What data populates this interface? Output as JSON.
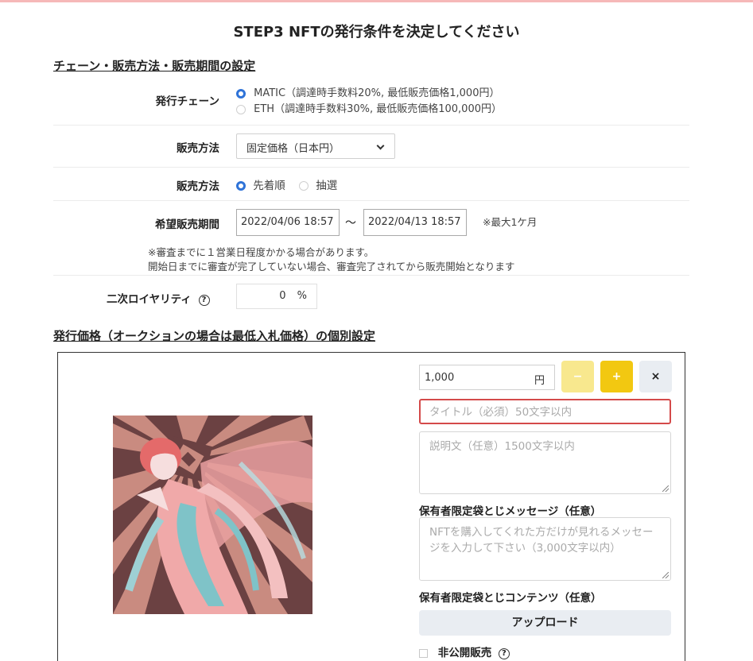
{
  "step_title": "STEP3 NFTの発行条件を決定してください",
  "section1_title": "チェーン・販売方法・販売期間の設定",
  "chain": {
    "label": "発行チェーン",
    "options": [
      {
        "text": "MATIC（調達時手数料20%, 最低販売価格1,000円）",
        "selected": true
      },
      {
        "text": "ETH（調達時手数料30%, 最低販売価格100,000円）",
        "selected": false
      }
    ]
  },
  "sale_method_1": {
    "label": "販売方法",
    "selected_value": "固定価格（日本円）"
  },
  "sale_method_2": {
    "label": "販売方法",
    "options": [
      {
        "text": "先着順",
        "selected": true
      },
      {
        "text": "抽選",
        "selected": false
      }
    ]
  },
  "period": {
    "label": "希望販売期間",
    "start": "2022/04/06 18:57",
    "separator": "〜",
    "end": "2022/04/13 18:57",
    "max_note": "※最大1ケ月",
    "review_note_1": "※審査までに１営業日程度かかる場合があります。",
    "review_note_2": "開始日までに審査が完了していない場合、審査完了されてから販売開始となります"
  },
  "royalty": {
    "label": "二次ロイヤリティ",
    "help_icon": "?",
    "value": "0",
    "unit": "%"
  },
  "section2_title": "発行価格（オークションの場合は最低入札価格）の個別設定",
  "item": {
    "price_value": "1,000",
    "price_unit": "円",
    "minus_label": "−",
    "plus_label": "+",
    "remove_label": "×",
    "title_placeholder": "タイトル（必須）50文字以内",
    "description_placeholder": "説明文（任意）1500文字以内",
    "message_label": "保有者限定袋とじメッセージ（任意）",
    "message_placeholder": "NFTを購入してくれた方だけが見れるメッセージを入力して下さい（3,000文字以内）",
    "contents_label": "保有者限定袋とじコンテンツ（任意）",
    "upload_label": "アップロード",
    "private_label": "非公開販売",
    "private_help_icon": "?"
  },
  "colors": {
    "accent_blue": "#2f73d8",
    "button_yellow": "#f2c811",
    "button_yellow_disabled": "#f8e88e",
    "error_red": "#d44a4a",
    "top_bar": "#f6b8b8"
  },
  "icons": {
    "select_arrow": "chevron-down-icon",
    "help": "question-circle-icon",
    "artwork": "nft-artwork-image"
  }
}
